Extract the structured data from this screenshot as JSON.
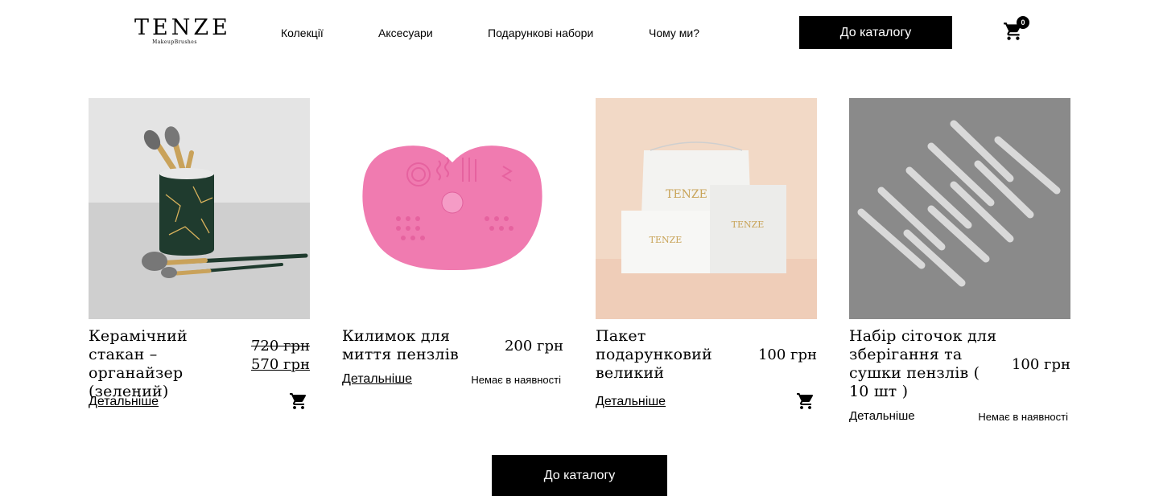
{
  "header": {
    "logo_main": "TENZE",
    "logo_sub": "MakeupBrushes",
    "nav": [
      "Колекції",
      "Аксесуари",
      "Подарункові набори",
      "Чому ми?"
    ],
    "catalog_button": "До каталогу",
    "cart_count": "0"
  },
  "products": [
    {
      "title": "Керамічний стакан – органайзер (зелений)",
      "price_old": "720 грн",
      "price_new": "570 грн",
      "details": "Детальніше",
      "image": "green marble brush holder with makeup brushes"
    },
    {
      "title": "Килимок для миття пензлів",
      "price": "200 грн",
      "details": "Детальніше",
      "stock": "Немає в наявності",
      "image": "pink silicone brush cleaning mat"
    },
    {
      "title": "Пакет подарунковий великий",
      "price": "100 грн",
      "details": "Детальніше",
      "image": "white TENZE gift bags"
    },
    {
      "title": "Набір сіточок для зберігання та сушки пензлів ( 10 шт )",
      "price": "100 грн",
      "details": "Детальніше",
      "stock": "Немає в наявності",
      "image": "brush guard mesh sleeves"
    }
  ],
  "bottom_button": "До каталогу",
  "colors": {
    "accent": "#000000",
    "background": "#ffffff"
  }
}
